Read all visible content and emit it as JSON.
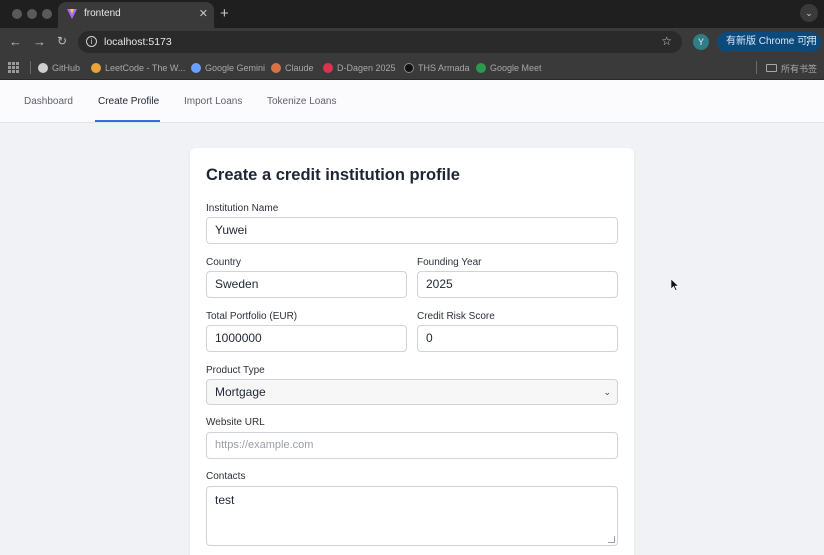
{
  "browser": {
    "tab_title": "frontend",
    "url": "localhost:5173",
    "profile_initial": "Y",
    "update_button": "有新版 Chrome 可用",
    "bookmarks": [
      {
        "label": "GitHub",
        "color": "#cfcfcf"
      },
      {
        "label": "LeetCode - The W...",
        "color": "#e8a33b"
      },
      {
        "label": "Google Gemini",
        "color": "#6aa0ff"
      },
      {
        "label": "Claude",
        "color": "#d4724a"
      },
      {
        "label": "D-Dagen 2025",
        "color": "#d9344e"
      },
      {
        "label": "THS Armada",
        "color": "#1f1f1f"
      },
      {
        "label": "Google Meet",
        "color": "#2c9a4c"
      }
    ],
    "all_bookmarks": "所有书签"
  },
  "nav": {
    "items": [
      "Dashboard",
      "Create Profile",
      "Import Loans",
      "Tokenize Loans"
    ],
    "active": "Create Profile"
  },
  "form": {
    "title": "Create a credit institution profile",
    "institution_name": {
      "label": "Institution Name",
      "value": "Yuwei"
    },
    "country": {
      "label": "Country",
      "value": "Sweden"
    },
    "founding_year": {
      "label": "Founding Year",
      "value": "2025"
    },
    "total_portfolio": {
      "label": "Total Portfolio (EUR)",
      "value": "1000000"
    },
    "credit_risk_score": {
      "label": "Credit Risk Score",
      "value": "0"
    },
    "product_type": {
      "label": "Product Type",
      "value": "Mortgage"
    },
    "website_url": {
      "label": "Website URL",
      "placeholder": "https://example.com"
    },
    "contacts": {
      "label": "Contacts",
      "value": "test"
    }
  },
  "colors": {
    "accent": "#2f6fe0",
    "page_bg": "#f1f2f5"
  }
}
